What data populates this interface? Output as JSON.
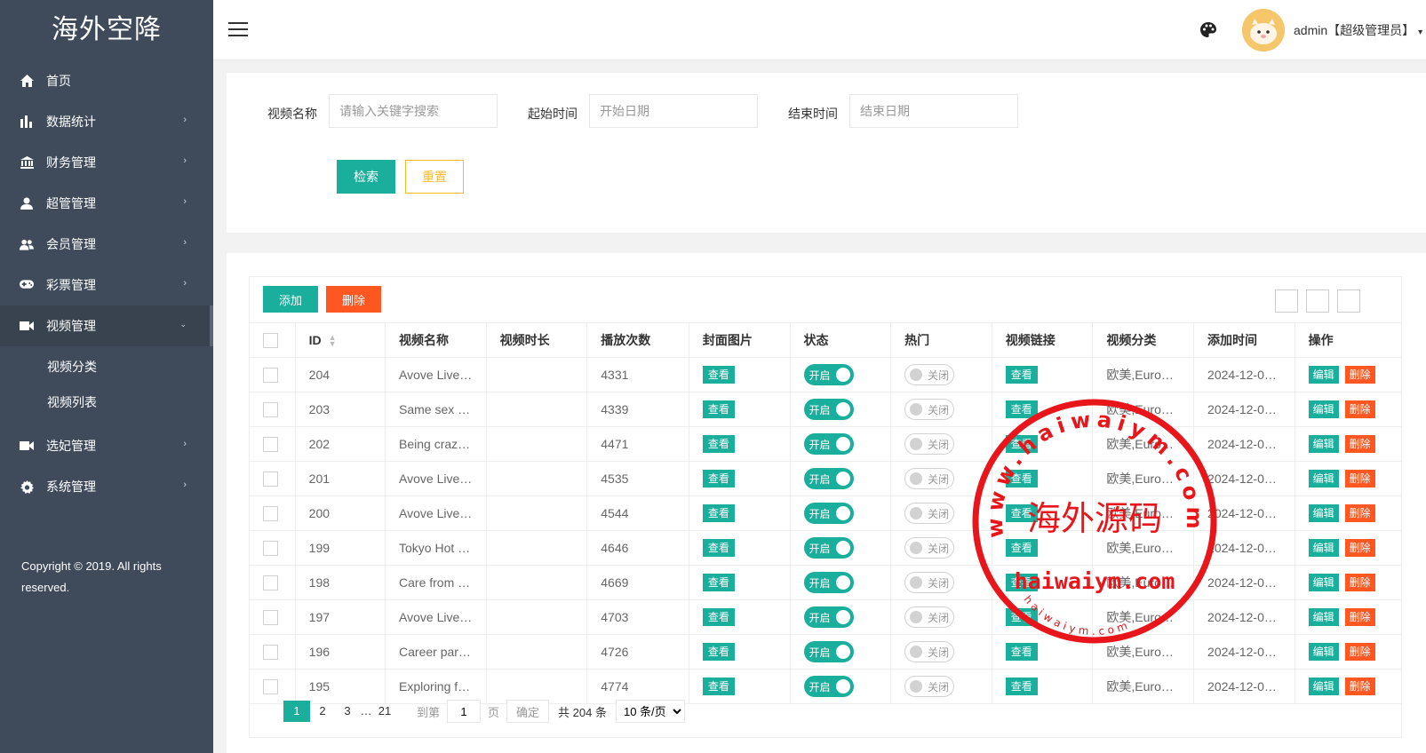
{
  "app": {
    "logo": "海外空降"
  },
  "sidebar": {
    "items": [
      {
        "label": "首页",
        "icon": "home-icon",
        "has_arrow": false
      },
      {
        "label": "数据统计",
        "icon": "bar-chart-icon",
        "has_arrow": true
      },
      {
        "label": "财务管理",
        "icon": "bank-icon",
        "has_arrow": true
      },
      {
        "label": "超管管理",
        "icon": "user-icon",
        "has_arrow": true
      },
      {
        "label": "会员管理",
        "icon": "users-icon",
        "has_arrow": true
      },
      {
        "label": "彩票管理",
        "icon": "gamepad-icon",
        "has_arrow": true
      },
      {
        "label": "视频管理",
        "icon": "video-icon",
        "has_arrow": true,
        "expanded": true
      },
      {
        "label": "选妃管理",
        "icon": "video-icon",
        "has_arrow": true
      },
      {
        "label": "系统管理",
        "icon": "gear-icon",
        "has_arrow": true
      }
    ],
    "sub_items": [
      "视频分类",
      "视频列表"
    ],
    "copyright": "Copyright © 2019. All rights reserved."
  },
  "header": {
    "admin_name": "admin【超级管理员】"
  },
  "search": {
    "name_label": "视频名称",
    "name_placeholder": "请输入关键字搜索",
    "start_label": "起始时间",
    "start_placeholder": "开始日期",
    "end_label": "结束时间",
    "end_placeholder": "结束日期",
    "search_btn": "检索",
    "reset_btn": "重置"
  },
  "toolbar": {
    "add_btn": "添加",
    "delete_btn": "删除"
  },
  "table": {
    "columns": [
      "ID",
      "视频名称",
      "视频时长",
      "播放次数",
      "封面图片",
      "状态",
      "热门",
      "视频链接",
      "视频分类",
      "添加时间",
      "操作"
    ],
    "view_label": "查看",
    "on_label": "开启",
    "off_label": "关闭",
    "edit_label": "编辑",
    "remove_label": "删除",
    "rows": [
      {
        "id": "204",
        "name": "Avove Live…",
        "duration": "",
        "plays": "4331",
        "category": "欧美,Euro…",
        "added": "2024-12-0…"
      },
      {
        "id": "203",
        "name": "Same sex …",
        "duration": "",
        "plays": "4339",
        "category": "欧美,Euro…",
        "added": "2024-12-0…"
      },
      {
        "id": "202",
        "name": "Being craz…",
        "duration": "",
        "plays": "4471",
        "category": "欧美,Euro…",
        "added": "2024-12-0…"
      },
      {
        "id": "201",
        "name": "Avove Live…",
        "duration": "",
        "plays": "4535",
        "category": "欧美,Euro…",
        "added": "2024-12-0…"
      },
      {
        "id": "200",
        "name": "Avove Live…",
        "duration": "",
        "plays": "4544",
        "category": "欧美,Euro…",
        "added": "2024-12-0…"
      },
      {
        "id": "199",
        "name": "Tokyo Hot …",
        "duration": "",
        "plays": "4646",
        "category": "欧美,Euro…",
        "added": "2024-12-0…"
      },
      {
        "id": "198",
        "name": "Care from …",
        "duration": "",
        "plays": "4669",
        "category": "欧美,Euro…",
        "added": "2024-12-0…"
      },
      {
        "id": "197",
        "name": "Avove Live…",
        "duration": "",
        "plays": "4703",
        "category": "欧美,Euro…",
        "added": "2024-12-0…"
      },
      {
        "id": "196",
        "name": "Career par…",
        "duration": "",
        "plays": "4726",
        "category": "欧美,Euro…",
        "added": "2024-12-0…"
      },
      {
        "id": "195",
        "name": "Exploring f…",
        "duration": "",
        "plays": "4774",
        "category": "欧美,Euro…",
        "added": "2024-12-0…"
      }
    ]
  },
  "pagination": {
    "pages": [
      "1",
      "2",
      "3",
      "…",
      "21"
    ],
    "current": "1",
    "goto_label": "到第",
    "goto_value": "1",
    "page_unit": "页",
    "confirm": "确定",
    "total": "共 204 条",
    "page_size": "10 条/页"
  },
  "watermark": {
    "arc_text": "www.haiwaiym.com",
    "center_text": "海外源码",
    "bottom_text": "haiwaiym.com",
    "small_arc": "haiwaiym.com"
  },
  "colors": {
    "sidebar_bg": "#3f4b5b",
    "primary": "#1aaf9c",
    "danger": "#ff5722",
    "warning": "#f7b924",
    "stamp": "#e8161b"
  }
}
